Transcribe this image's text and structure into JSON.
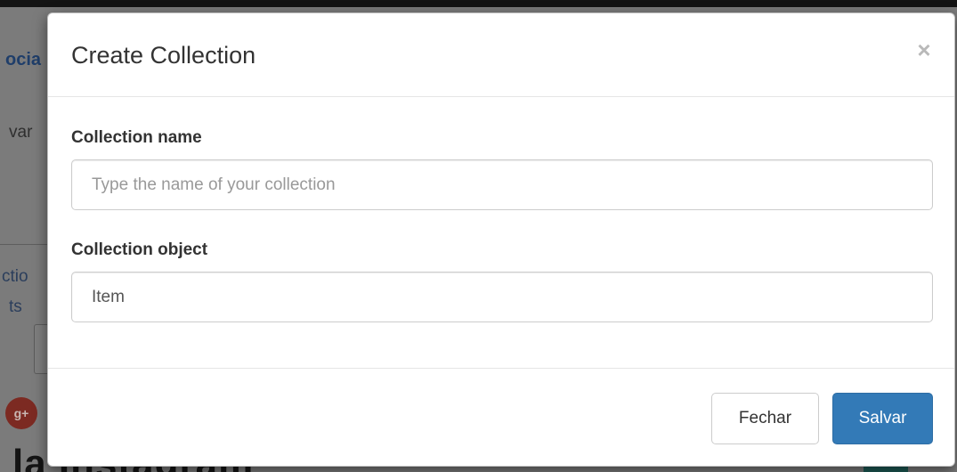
{
  "background": {
    "fragments": {
      "link_top": "ocia",
      "text_mid": "var",
      "link_a": "ctio",
      "link_b": "ts",
      "gplus_badge": "g+",
      "heading": "la Instagram"
    }
  },
  "modal": {
    "title": "Create Collection",
    "close_glyph": "×",
    "fields": {
      "name": {
        "label": "Collection name",
        "value": "",
        "placeholder": "Type the name of your collection"
      },
      "object": {
        "label": "Collection object",
        "value": "Item",
        "placeholder": ""
      }
    },
    "footer": {
      "close_label": "Fechar",
      "save_label": "Salvar"
    }
  },
  "colors": {
    "primary": "#337ab7",
    "overlay": "#7b7b7b"
  }
}
